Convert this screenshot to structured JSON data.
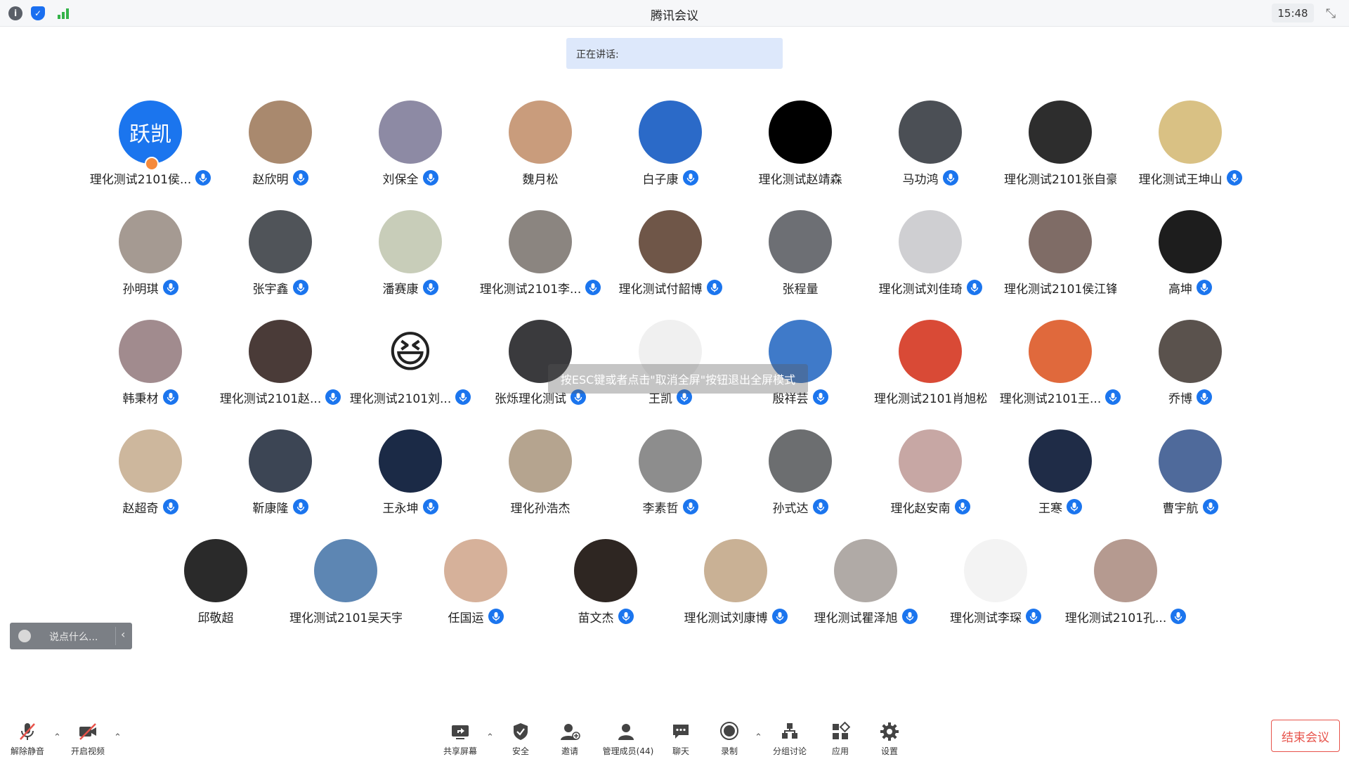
{
  "titlebar": {
    "title": "腾讯会议",
    "clock": "15:48"
  },
  "speaking": {
    "label": "正在讲话:"
  },
  "overlay": {
    "hint": "按ESC键或者点击\"取消全屏\"按钮退出全屏模式"
  },
  "chat": {
    "placeholder": "说点什么..."
  },
  "participants": [
    {
      "name": "理化测试2101侯...",
      "avatar_text": "跃凯",
      "color": "#1b75ee",
      "mic": true,
      "host": true
    },
    {
      "name": "赵欣明",
      "color": "#a9896e",
      "mic": true
    },
    {
      "name": "刘保全",
      "color": "#8d8aa4",
      "mic": true
    },
    {
      "name": "魏月松",
      "color": "#c99c7c",
      "mic": false
    },
    {
      "name": "白子康",
      "color": "#2b6ac8",
      "mic": true
    },
    {
      "name": "理化测试赵靖森",
      "color": "#000000",
      "mic": false
    },
    {
      "name": "马功鸿",
      "color": "#4b4f55",
      "mic": true
    },
    {
      "name": "理化测试2101张自豪",
      "color": "#2d2d2d",
      "mic": false
    },
    {
      "name": "理化测试王坤山",
      "color": "#d9c184",
      "mic": true
    },
    {
      "name": "孙明琪",
      "color": "#a59a92",
      "mic": true
    },
    {
      "name": "张宇鑫",
      "color": "#505459",
      "mic": true
    },
    {
      "name": "潘赛康",
      "color": "#c8cdb9",
      "mic": true
    },
    {
      "name": "理化测试2101李...",
      "color": "#8b8580",
      "mic": true
    },
    {
      "name": "理化测试付韶博",
      "color": "#6f5648",
      "mic": true
    },
    {
      "name": "张程量",
      "color": "#6d6f74",
      "mic": false
    },
    {
      "name": "理化测试刘佳琦",
      "color": "#cfcfd2",
      "mic": true
    },
    {
      "name": "理化测试2101侯江锋",
      "color": "#7f6c66",
      "mic": false
    },
    {
      "name": "高坤",
      "color": "#1d1d1d",
      "mic": true
    },
    {
      "name": "韩秉材",
      "color": "#a18b8e",
      "mic": true
    },
    {
      "name": "理化测试2101赵...",
      "color": "#4a3b38",
      "mic": true
    },
    {
      "name": "理化测试2101刘...",
      "emoji": "😆",
      "color": "#ffffff",
      "mic": true
    },
    {
      "name": "张烁理化测试",
      "color": "#3a3a3d",
      "mic": true
    },
    {
      "name": "王凯",
      "color": "#f0f0f0",
      "mic": true
    },
    {
      "name": "殷祥芸",
      "color": "#3f7ac9",
      "mic": true
    },
    {
      "name": "理化测试2101肖旭松",
      "color": "#d94a36",
      "mic": false
    },
    {
      "name": "理化测试2101王...",
      "color": "#e0693c",
      "mic": true
    },
    {
      "name": "乔博",
      "color": "#5a524d",
      "mic": true
    },
    {
      "name": "赵超奇",
      "color": "#cdb79d",
      "mic": true
    },
    {
      "name": "靳康隆",
      "color": "#3c4554",
      "mic": true
    },
    {
      "name": "王永坤",
      "color": "#1b2a46",
      "mic": true
    },
    {
      "name": "理化孙浩杰",
      "color": "#b5a48f",
      "mic": false
    },
    {
      "name": "李素哲",
      "color": "#8d8d8d",
      "mic": true
    },
    {
      "name": "孙式达",
      "color": "#6c6e70",
      "mic": true
    },
    {
      "name": "理化赵安南",
      "color": "#c7a7a4",
      "mic": true
    },
    {
      "name": "王寒",
      "color": "#1f2c47",
      "mic": true
    },
    {
      "name": "曹宇航",
      "color": "#4f6a9b",
      "mic": true
    },
    {
      "name": "邱敬超",
      "color": "#2a2a2a",
      "mic": false
    },
    {
      "name": "理化测试2101吴天宇",
      "color": "#5d86b3",
      "mic": false
    },
    {
      "name": "任国运",
      "color": "#d6b19a",
      "mic": true
    },
    {
      "name": "苗文杰",
      "color": "#2e2622",
      "mic": true
    },
    {
      "name": "理化测试刘康博",
      "color": "#c9b195",
      "mic": true
    },
    {
      "name": "理化测试瞿泽旭",
      "color": "#b0aaa6",
      "mic": true
    },
    {
      "name": "理化测试李琛",
      "color": "#f3f3f3",
      "mic": true
    },
    {
      "name": "理化测试2101孔...",
      "color": "#b59a90",
      "mic": true
    }
  ],
  "toolbar": {
    "unmute": "解除静音",
    "video": "开启视频",
    "share": "共享屏幕",
    "security": "安全",
    "invite": "邀请",
    "members": "管理成员(44)",
    "chat": "聊天",
    "record": "录制",
    "breakout": "分组讨论",
    "apps": "应用",
    "settings": "设置",
    "end": "结束会议"
  },
  "colors": {
    "accent": "#1b75ee",
    "danger": "#e7534b",
    "speaking_bg": "#dde8fb"
  }
}
